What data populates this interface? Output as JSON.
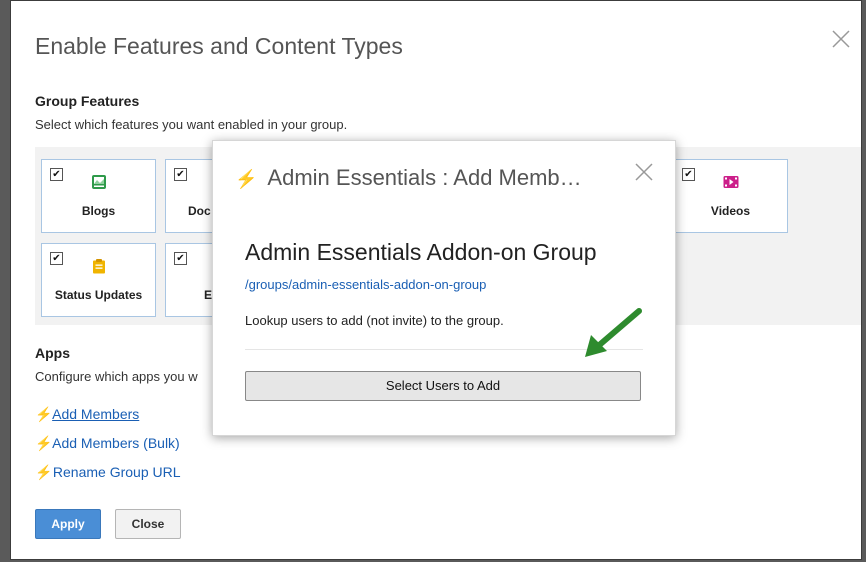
{
  "modal": {
    "title": "Enable Features and Content Types",
    "group_features": {
      "title": "Group Features",
      "description": "Select which features you want enabled in your group."
    },
    "features": [
      {
        "label": "Blogs",
        "checked": true,
        "icon": "blog-icon",
        "color": "#2e9a4a"
      },
      {
        "label": "Doc",
        "checked": true,
        "icon": "document-icon"
      },
      {
        "label": "Videos",
        "checked": true,
        "icon": "video-icon",
        "color": "#cc1f8a"
      },
      {
        "label": "Status Updates",
        "checked": true,
        "icon": "status-updates-icon",
        "color": "#f0b400"
      },
      {
        "label": "E",
        "checked": true,
        "icon": "feature-icon"
      }
    ],
    "apps": {
      "title": "Apps",
      "description": "Configure which apps you w",
      "links": [
        "Add Members",
        "Add Members (Bulk)",
        "Rename Group URL"
      ]
    },
    "buttons": {
      "apply": "Apply",
      "close": "Close"
    }
  },
  "popup": {
    "title": "Admin Essentials : Add Memb…",
    "heading": "Admin Essentials Addon-on Group",
    "link": "/groups/admin-essentials-addon-on-group",
    "description": "Lookup users to add (not invite) to the group.",
    "button": "Select Users to Add"
  },
  "colors": {
    "accent": "#4a8ed6",
    "link": "#1a5fb4",
    "bolt": "#f0a020",
    "arrow": "#2e8b2e"
  }
}
